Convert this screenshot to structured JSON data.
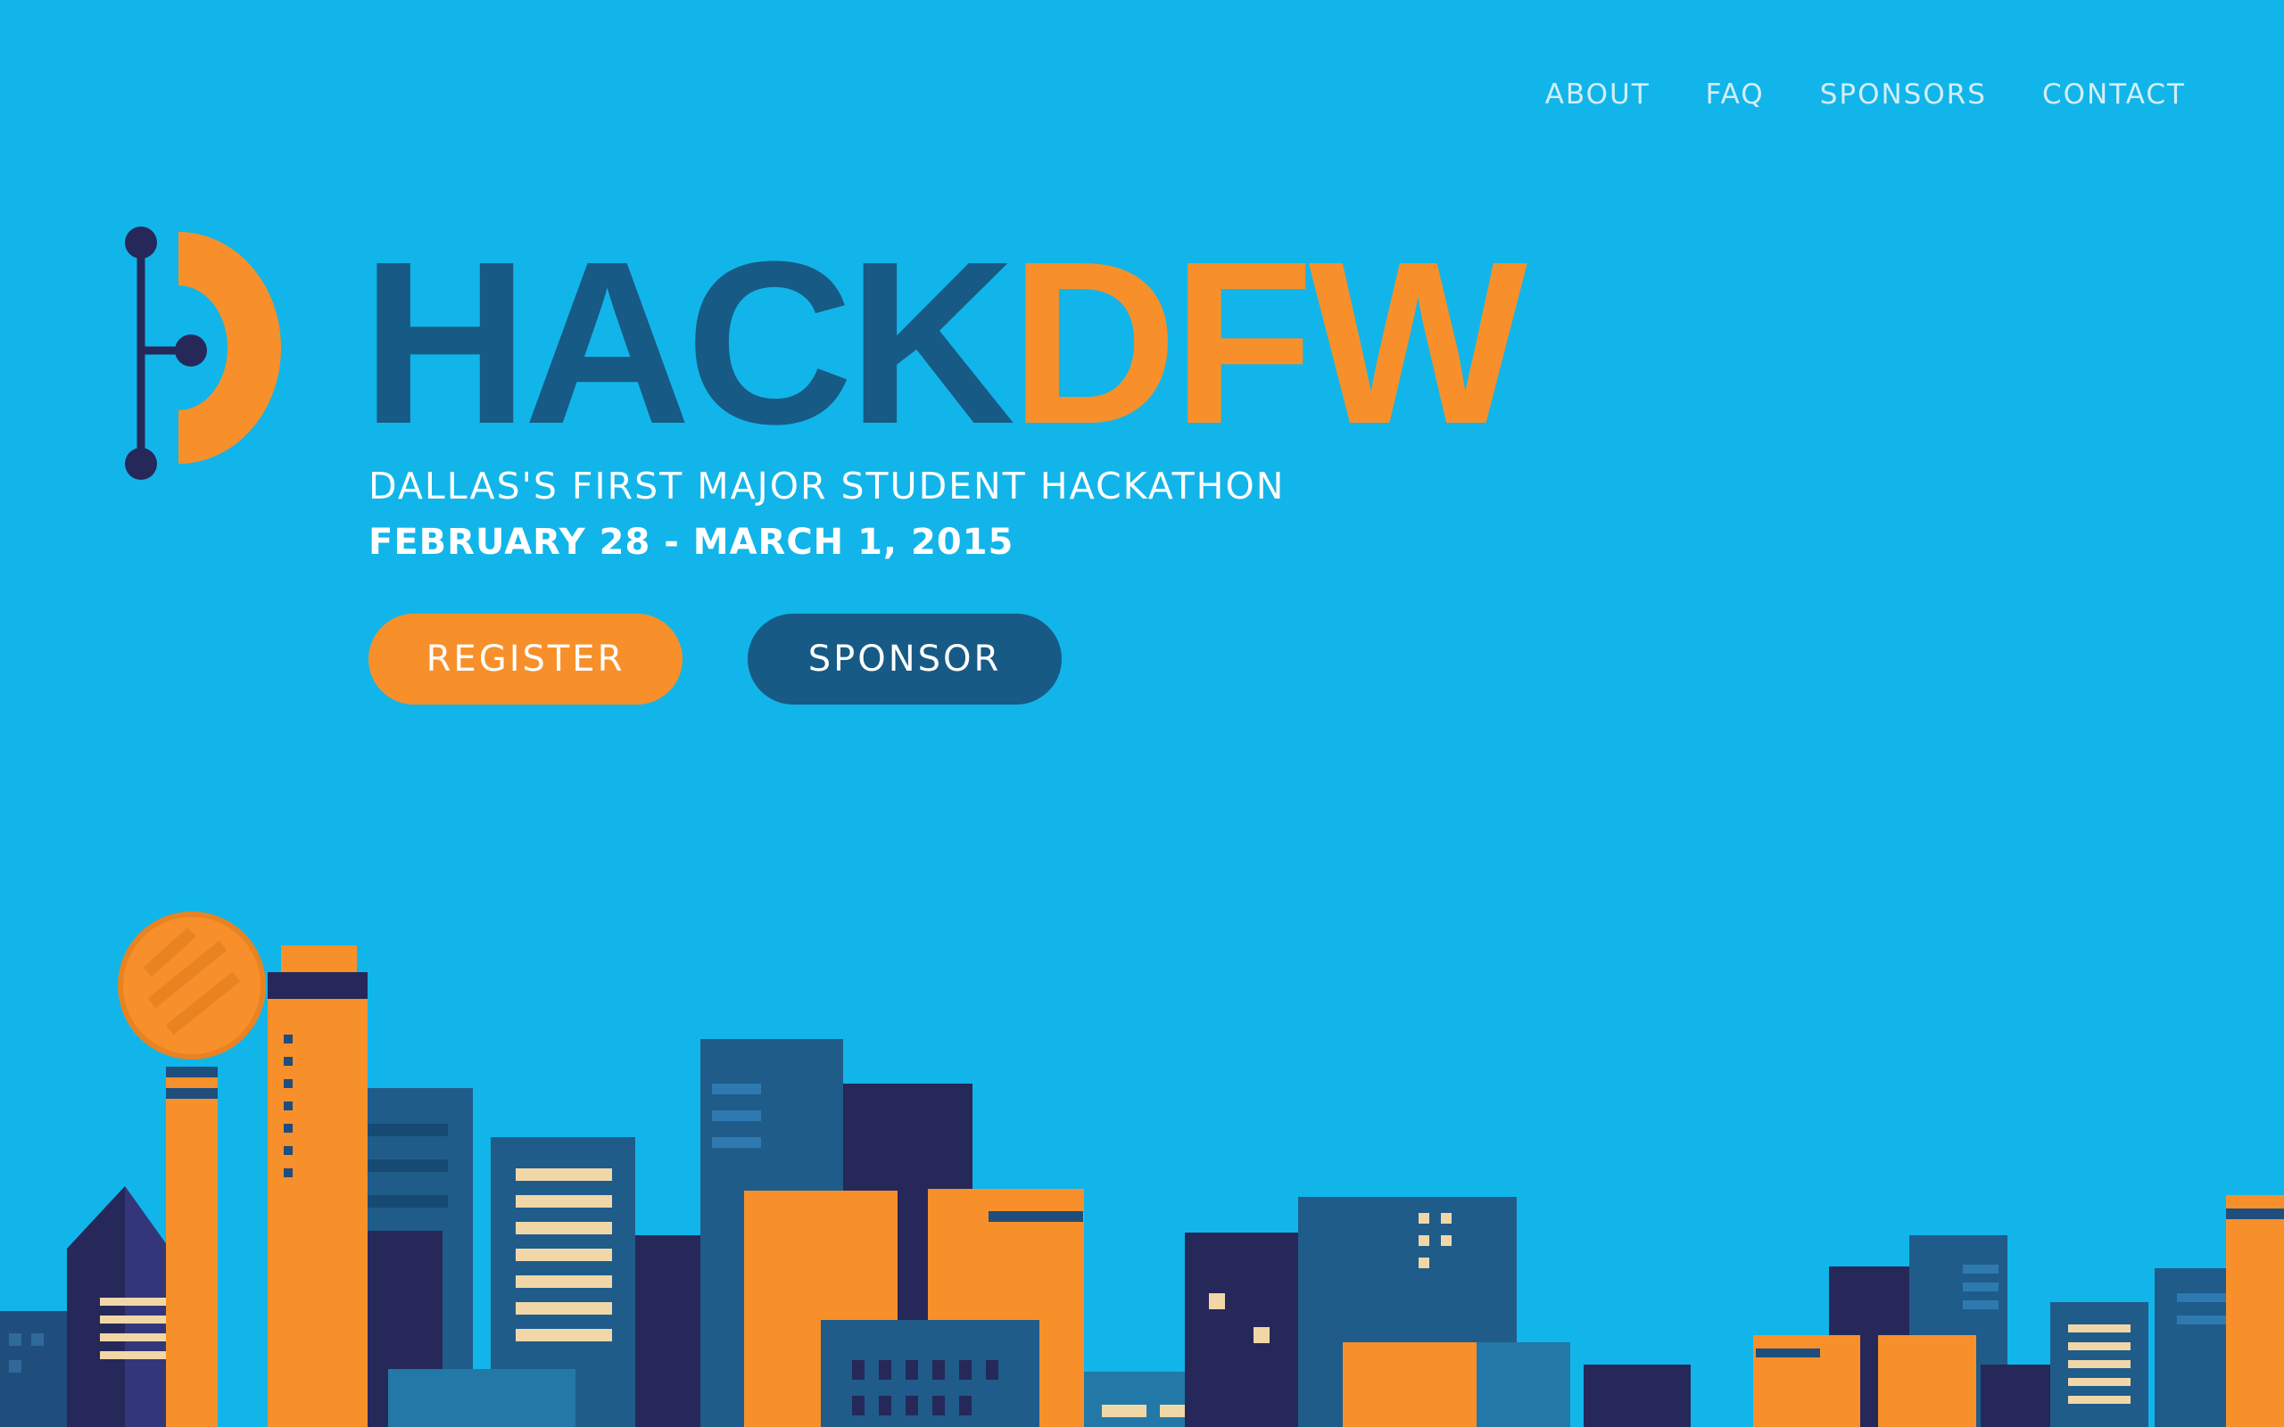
{
  "nav": {
    "items": [
      {
        "label": "ABOUT"
      },
      {
        "label": "FAQ"
      },
      {
        "label": "SPONSORS"
      },
      {
        "label": "CONTACT"
      }
    ]
  },
  "hero": {
    "title_part1": "HACK",
    "title_part2": "DFW",
    "tagline": "DALLAS'S FIRST MAJOR STUDENT HACKATHON",
    "dates": "FEBRUARY 28 - MARCH 1, 2015",
    "register_label": "REGISTER",
    "sponsor_label": "SPONSOR"
  },
  "colors": {
    "background": "#12B5E9",
    "brand_dark": "#175A85",
    "brand_orange": "#F7902A",
    "nav_text": "#D3EEF8",
    "navy": "#26285A"
  },
  "icons": {
    "logo": "hackdfw-circuit-d-logo"
  }
}
